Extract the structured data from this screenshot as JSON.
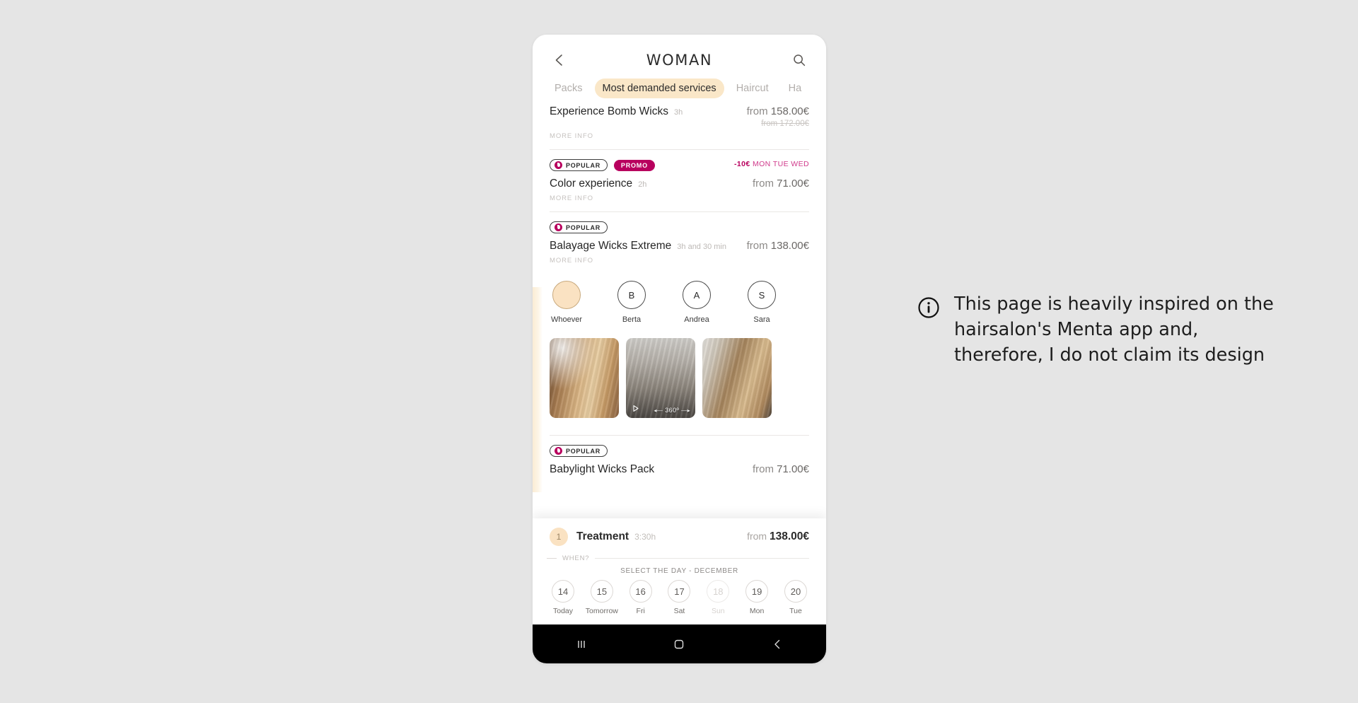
{
  "header": {
    "title": "WOMAN",
    "back_icon": "chevron-left-icon",
    "search_icon": "search-icon"
  },
  "tabs": [
    {
      "label": "Packs",
      "active": false
    },
    {
      "label": "Most demanded services",
      "active": true
    },
    {
      "label": "Haircut",
      "active": false
    },
    {
      "label": "Ha",
      "active": false
    }
  ],
  "services": [
    {
      "name": "Experience Bomb Wicks",
      "duration": "3h",
      "price_prefix": "from",
      "price": "158.00€",
      "old_price": "from 172.00€",
      "more_info": "MORE INFO",
      "badges": [],
      "promo_note": ""
    },
    {
      "name": "Color experience",
      "duration": "2h",
      "price_prefix": "from",
      "price": "71.00€",
      "old_price": "",
      "more_info": "MORE INFO",
      "badges": [
        "POPULAR",
        "PROMO"
      ],
      "promo_discount": "-10€",
      "promo_days": "MON TUE WED"
    },
    {
      "name": "Balayage Wicks Extreme",
      "duration": "3h and 30 min",
      "price_prefix": "from",
      "price": "138.00€",
      "old_price": "",
      "more_info": "MORE INFO",
      "badges": [
        "POPULAR"
      ],
      "promo_note": ""
    },
    {
      "name": "Babylight Wicks Pack",
      "duration": "",
      "price_prefix": "from",
      "price": "71.00€",
      "old_price": "",
      "more_info": "",
      "badges": [
        "POPULAR"
      ],
      "promo_note": ""
    }
  ],
  "badge_labels": {
    "popular": "POPULAR",
    "promo": "PROMO"
  },
  "stylists": [
    {
      "initial": "",
      "name": "Whoever",
      "selected": true
    },
    {
      "initial": "B",
      "name": "Berta",
      "selected": false
    },
    {
      "initial": "A",
      "name": "Andrea",
      "selected": false
    },
    {
      "initial": "S",
      "name": "Sara",
      "selected": false
    }
  ],
  "gallery": [
    {
      "alt": "balayage-long-wavy-hair-back",
      "badge": "",
      "play": false
    },
    {
      "alt": "balayage-wavy-hair-salon-video",
      "badge": "360º",
      "play": true
    },
    {
      "alt": "balayage-blonde-hair-front",
      "badge": "",
      "play": false
    }
  ],
  "booking": {
    "count": "1",
    "treatment_label": "Treatment",
    "duration": "3:30h",
    "price_prefix": "from",
    "price": "138.00€",
    "when_label": "WHEN?",
    "select_day_label": "SELECT THE DAY - DECEMBER",
    "days": [
      {
        "num": "14",
        "label": "Today",
        "disabled": false
      },
      {
        "num": "15",
        "label": "Tomorrow",
        "disabled": false
      },
      {
        "num": "16",
        "label": "Fri",
        "disabled": false
      },
      {
        "num": "17",
        "label": "Sat",
        "disabled": false
      },
      {
        "num": "18",
        "label": "Sun",
        "disabled": true
      },
      {
        "num": "19",
        "label": "Mon",
        "disabled": false
      },
      {
        "num": "20",
        "label": "Tue",
        "disabled": false
      }
    ]
  },
  "navbar": {
    "recents_icon": "recents-icon",
    "home_icon": "home-icon",
    "back_icon": "back-icon"
  },
  "annotation": {
    "icon": "info-icon",
    "text": "This page is heavily inspired on the hairsalon's Menta app and, therefore, I do not claim its design"
  },
  "colors": {
    "background": "#e5e5e5",
    "accent_cream": "#fae7c8",
    "promo_magenta": "#b8005e",
    "promo_pink": "#d0398b"
  }
}
